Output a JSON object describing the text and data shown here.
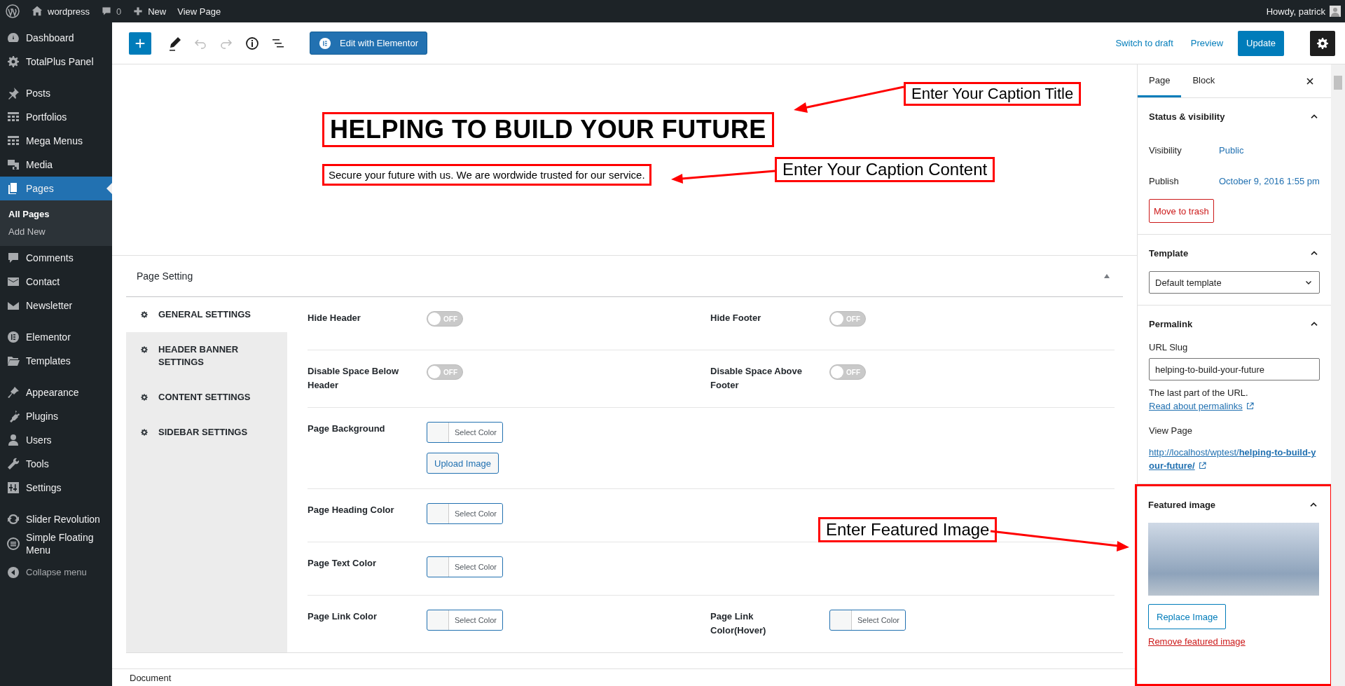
{
  "admin_bar": {
    "site": "wordpress",
    "comments": "0",
    "new": "New",
    "view_page": "View Page",
    "howdy": "Howdy, patrick"
  },
  "sidebar": {
    "groups": [
      {
        "items": [
          {
            "label": "Dashboard",
            "selected": false
          },
          {
            "label": "TotalPlus Panel",
            "selected": false
          }
        ]
      },
      {
        "items": [
          {
            "label": "Posts",
            "selected": false
          },
          {
            "label": "Portfolios",
            "selected": false
          },
          {
            "label": "Mega Menus",
            "selected": false
          },
          {
            "label": "Media",
            "selected": false
          },
          {
            "label": "Pages",
            "selected": true,
            "children": [
              {
                "label": "All Pages",
                "selected": true
              },
              {
                "label": "Add New",
                "selected": false
              }
            ]
          },
          {
            "label": "Comments",
            "selected": false
          },
          {
            "label": "Contact",
            "selected": false
          },
          {
            "label": "Newsletter",
            "selected": false
          }
        ]
      },
      {
        "items": [
          {
            "label": "Elementor",
            "selected": false
          },
          {
            "label": "Templates",
            "selected": false
          }
        ]
      },
      {
        "items": [
          {
            "label": "Appearance",
            "selected": false
          },
          {
            "label": "Plugins",
            "selected": false
          },
          {
            "label": "Users",
            "selected": false
          },
          {
            "label": "Tools",
            "selected": false
          },
          {
            "label": "Settings",
            "selected": false
          }
        ]
      },
      {
        "items": [
          {
            "label": "Slider Revolution",
            "selected": false
          },
          {
            "label": "Simple Floating Menu",
            "selected": false
          }
        ]
      }
    ],
    "collapse": "Collapse menu"
  },
  "toolbar": {
    "elementor": "Edit with Elementor",
    "switch_draft": "Switch to draft",
    "preview": "Preview",
    "update": "Update"
  },
  "block": {
    "title": "HELPING TO BUILD YOUR FUTURE",
    "content": "Secure your future with us. We are wordwide trusted for our service."
  },
  "annotations": [
    {
      "text": "Enter Your Caption Title"
    },
    {
      "text": "Enter Your Caption Content"
    },
    {
      "text": "Enter Featured Image"
    }
  ],
  "page_setting": {
    "title": "Page Setting",
    "expanded": true,
    "tabs": [
      {
        "label": "GENERAL SETTINGS",
        "selected": true
      },
      {
        "label": "HEADER BANNER SETTINGS",
        "selected": false
      },
      {
        "label": "CONTENT SETTINGS",
        "selected": false
      },
      {
        "label": "SIDEBAR SETTINGS",
        "selected": false
      }
    ],
    "rows": [
      {
        "fields": [
          {
            "label": "Hide Header",
            "controls": [
              {
                "kind": "toggle",
                "on": false,
                "text": "OFF"
              }
            ]
          },
          {
            "label": "Hide Footer",
            "controls": [
              {
                "kind": "toggle",
                "on": false,
                "text": "OFF"
              }
            ]
          }
        ]
      },
      {
        "fields": [
          {
            "label": "Disable Space Below Header",
            "controls": [
              {
                "kind": "toggle",
                "on": false,
                "text": "OFF"
              }
            ]
          },
          {
            "label": "Disable Space Above Footer",
            "controls": [
              {
                "kind": "toggle",
                "on": false,
                "text": "OFF"
              }
            ]
          }
        ]
      },
      {
        "fields": [
          {
            "label": "Page Background",
            "controls": [
              {
                "kind": "color",
                "text": "Select Color"
              },
              {
                "kind": "button",
                "text": "Upload Image"
              }
            ]
          }
        ]
      },
      {
        "fields": [
          {
            "label": "Page Heading Color",
            "controls": [
              {
                "kind": "color",
                "text": "Select Color"
              }
            ]
          }
        ]
      },
      {
        "fields": [
          {
            "label": "Page Text Color",
            "controls": [
              {
                "kind": "color",
                "text": "Select Color"
              }
            ]
          }
        ]
      },
      {
        "fields": [
          {
            "label": "Page Link Color",
            "controls": [
              {
                "kind": "color",
                "text": "Select Color"
              }
            ]
          },
          {
            "label": "Page Link Color(Hover)",
            "controls": [
              {
                "kind": "color",
                "text": "Select Color"
              }
            ]
          }
        ]
      }
    ]
  },
  "status_bar": "Document",
  "settings_panel": {
    "tabs": [
      {
        "label": "Page",
        "selected": true
      },
      {
        "label": "Block",
        "selected": false
      }
    ],
    "status": {
      "title": "Status & visibility",
      "expanded": true,
      "visibility_label": "Visibility",
      "visibility": "Public",
      "publish_label": "Publish",
      "publish": "October 9, 2016 1:55 pm",
      "trash": "Move to trash"
    },
    "template": {
      "title": "Template",
      "expanded": true,
      "value": "Default template"
    },
    "permalink": {
      "title": "Permalink",
      "expanded": true,
      "slug_label": "URL Slug",
      "slug": "helping-to-build-your-future",
      "help": "The last part of the URL.",
      "help_link": "Read about permalinks",
      "view_label": "View Page",
      "url": "http://localhost/wptest/**helping-to-build-your-future/**"
    },
    "featured": {
      "title": "Featured image",
      "expanded": true,
      "replace": "Replace Image",
      "remove": "Remove featured image"
    }
  }
}
